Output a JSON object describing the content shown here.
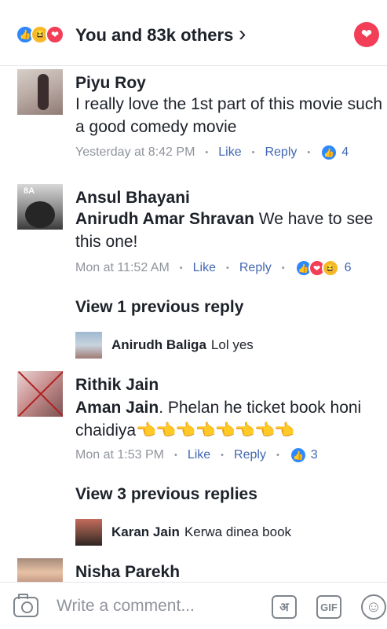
{
  "header": {
    "summary": "You and 83k others",
    "chevron": "›",
    "reaction_icons": [
      "like-icon",
      "haha-icon",
      "love-icon"
    ],
    "heart_button_icon": "heart-icon",
    "colors": {
      "like": "#2d88ff",
      "love": "#f33e58",
      "haha": "#f7b928"
    }
  },
  "comments": [
    {
      "author": "Piyu Roy",
      "text": "I really love the 1st part of this movie such a good comedy movie",
      "time": "Yesterday at 8:42 PM",
      "like_label": "Like",
      "reply_label": "Reply",
      "reaction_count": "4"
    },
    {
      "author": "Ansul Bhayani",
      "avatar_tag": "8A",
      "mention": "Anirudh Amar Shravan",
      "text": " We have to see this one!",
      "time": "Mon at 11:52 AM",
      "like_label": "Like",
      "reply_label": "Reply",
      "reaction_count": "6",
      "view_previous": "View 1 previous reply",
      "reply": {
        "author": "Anirudh Baliga",
        "text": "Lol yes"
      }
    },
    {
      "author": "Rithik Jain",
      "mention": "Aman Jain",
      "text": ". Phelan he ticket book honi chaidiya",
      "emojis": "👈👈👈👈👈👈👈👈",
      "time": "Mon at 1:53 PM",
      "like_label": "Like",
      "reply_label": "Reply",
      "reaction_count": "3",
      "view_previous": "View 3 previous replies",
      "reply": {
        "author": "Karan Jain",
        "text": "Kerwa dinea book"
      }
    },
    {
      "author": "Nisha Parekh"
    }
  ],
  "composer": {
    "placeholder": "Write a comment...",
    "camera_icon": "camera-icon",
    "hindi_label": "अ",
    "gif_label": "GIF",
    "sticker_icon": "smiley-icon"
  }
}
